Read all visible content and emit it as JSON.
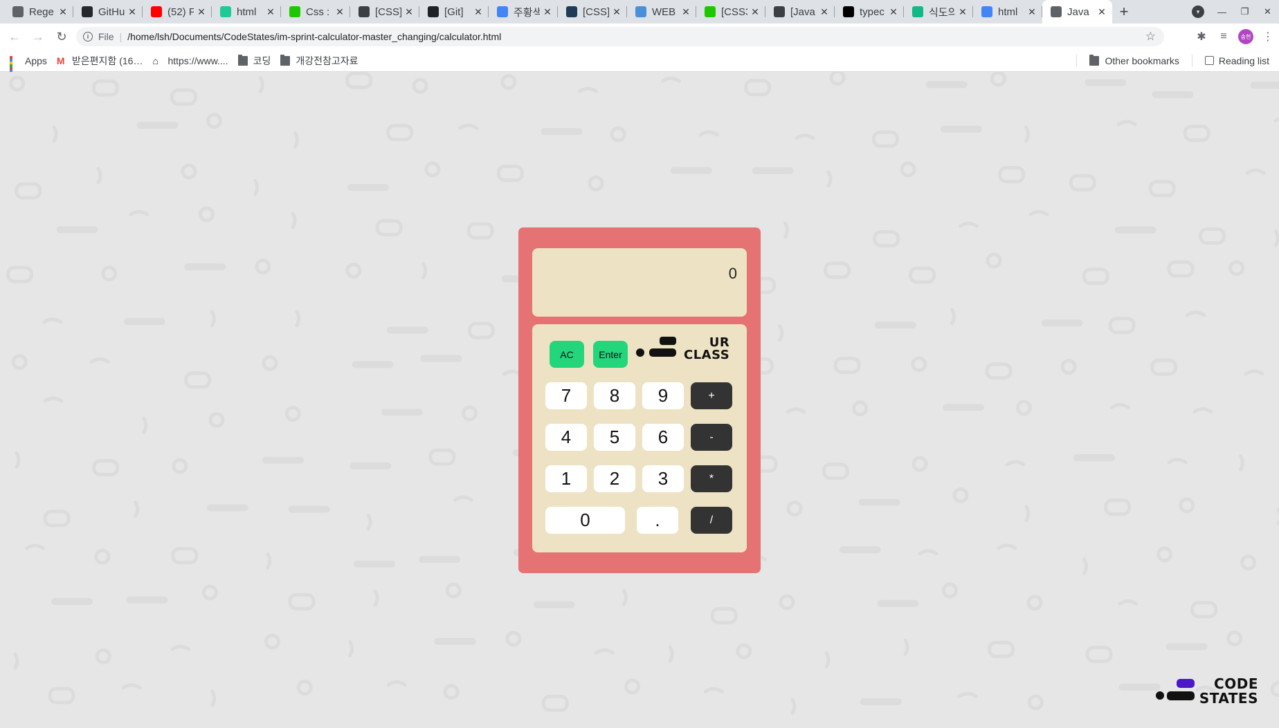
{
  "browser": {
    "tabs": [
      {
        "title": "Rege",
        "icon": "regex-icon",
        "color": "#5f6368"
      },
      {
        "title": "GitHu",
        "icon": "github-icon",
        "color": "#24292e"
      },
      {
        "title": "(52) F",
        "icon": "youtube-icon",
        "color": "#ff0000"
      },
      {
        "title": "html",
        "icon": "velog-icon",
        "color": "#20c997"
      },
      {
        "title": "Css : ",
        "icon": "chat-icon",
        "color": "#1ec800"
      },
      {
        "title": "[CSS]",
        "icon": "tistory-icon",
        "color": "#3c4043"
      },
      {
        "title": "[Git] ",
        "icon": "chart-icon",
        "color": "#202124"
      },
      {
        "title": "주황색",
        "icon": "google-icon",
        "color": "#4285f4"
      },
      {
        "title": "[CSS]",
        "icon": "box-icon",
        "color": "#1f3b57"
      },
      {
        "title": "WEB",
        "icon": "web-icon",
        "color": "#4a90d9"
      },
      {
        "title": "[CSS3",
        "icon": "chat-icon",
        "color": "#1ec800"
      },
      {
        "title": "[Java",
        "icon": "tistory-icon",
        "color": "#3c4043"
      },
      {
        "title": "typec",
        "icon": "type-icon",
        "color": "#000000"
      },
      {
        "title": "식도의",
        "icon": "plus-icon",
        "color": "#12b886"
      },
      {
        "title": "html",
        "icon": "google-icon",
        "color": "#4285f4"
      },
      {
        "title": "Java",
        "icon": "globe-icon",
        "color": "#5f6368",
        "active": true
      }
    ],
    "url_scheme": "File",
    "url": "/home/lsh/Documents/CodeStates/im-sprint-calculator-master_changing/calculator.html",
    "avatar_text": "송현",
    "bookmarks": [
      {
        "label": "Apps",
        "icon": "apps-icon"
      },
      {
        "label": "받은편지함 (16…",
        "icon": "gmail-icon"
      },
      {
        "label": "https://www....",
        "icon": "site-icon"
      },
      {
        "label": "코딩",
        "icon": "folder-icon"
      },
      {
        "label": "개강전참고자료",
        "icon": "folder-icon"
      }
    ],
    "other_bookmarks": "Other bookmarks",
    "reading_list": "Reading list"
  },
  "calculator": {
    "display": "0",
    "logo_line1": "UR",
    "logo_line2": "CLASS",
    "functions": [
      "AC",
      "Enter"
    ],
    "numbers": [
      "7",
      "8",
      "9",
      "4",
      "5",
      "6",
      "1",
      "2",
      "3",
      "0",
      "."
    ],
    "operators": [
      "+",
      "-",
      "*",
      "/"
    ]
  },
  "brand": {
    "line1": "CODE",
    "line2": "STATES"
  },
  "colors": {
    "calculator_body": "#e57373",
    "display_bg": "#ede3c4",
    "function_button": "#23d67c",
    "operator_button": "#333333",
    "number_button": "#ffffff",
    "brand_accent": "#4a18c9"
  }
}
